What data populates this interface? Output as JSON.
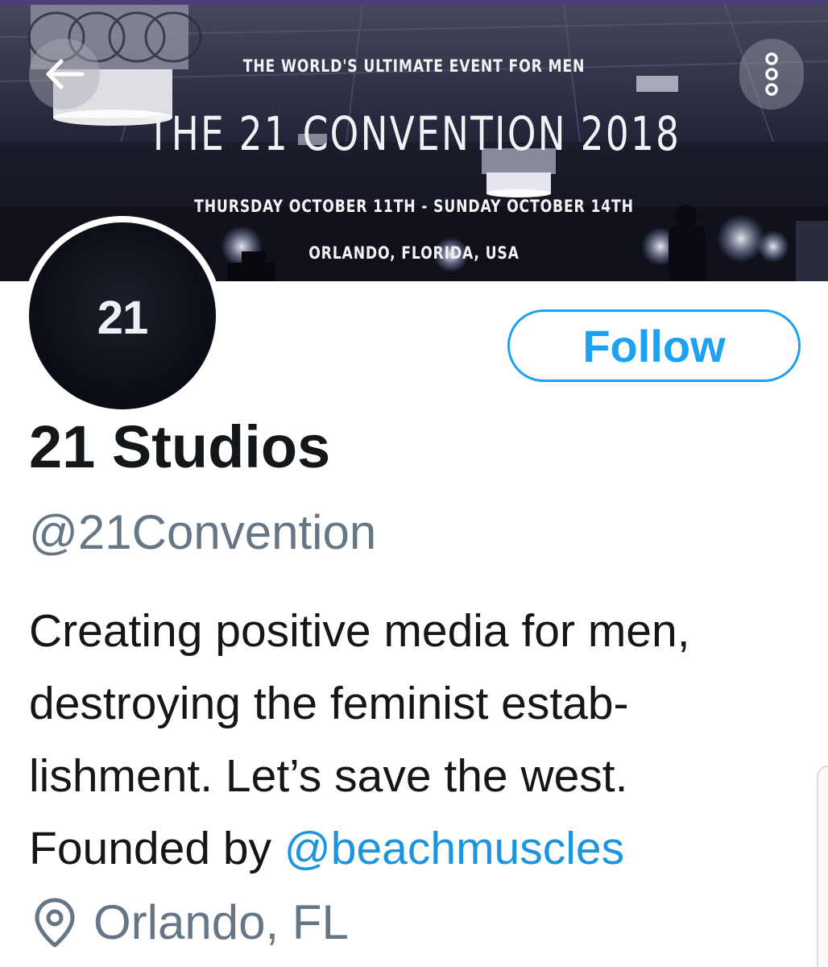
{
  "banner": {
    "tagline": "THE WORLD'S ULTIMATE EVENT FOR MEN",
    "title": "THE 21 CONVENTION 2018",
    "dates": "THURSDAY OCTOBER 11TH - SUNDAY OCTOBER 14TH",
    "location": "ORLANDO, FLORIDA, USA"
  },
  "header": {
    "back_icon": "arrow-left-icon",
    "more_icon": "more-vertical-icon"
  },
  "profile": {
    "avatar_text": "21",
    "follow_label": "Follow",
    "display_name": "21 Studios",
    "handle": "@21Convention",
    "bio": {
      "line1": "Creating positive media for men,",
      "line2": "destroying the feminist estab-",
      "line3": "lishment. Let’s save the west.",
      "line4_prefix": "Founded by ",
      "line4_mention": "@beachmuscles"
    },
    "location": "Orlando, FL",
    "location_icon": "map-pin-icon"
  },
  "colors": {
    "accent": "#1da1f2",
    "mention": "#1b95e0",
    "secondary_text": "#657786",
    "primary_text": "#14171a"
  }
}
